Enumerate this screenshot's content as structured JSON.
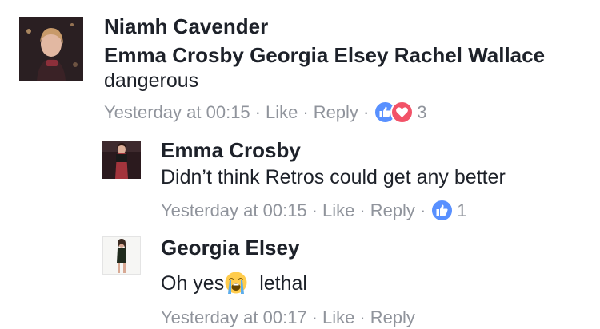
{
  "comment": {
    "author": "Niamh Cavender",
    "tags": "Emma Crosby Georgia Elsey Rachel Wallace",
    "text": "dangerous",
    "time": "Yesterday at 00:15",
    "like": "Like",
    "reply": "Reply",
    "dot": "·",
    "reactions": {
      "icons": [
        "like-icon",
        "love-icon"
      ],
      "count": "3"
    }
  },
  "replies": [
    {
      "author": "Emma Crosby",
      "text": "Didn’t think Retros could get any better",
      "time": "Yesterday at 00:15",
      "like": "Like",
      "reply": "Reply",
      "reactions": {
        "icons": [
          "like-icon"
        ],
        "count": "1"
      }
    },
    {
      "author": "Georgia Elsey",
      "text_before": "Oh yes",
      "emoji": "loudly-crying-face-emoji",
      "text_after": "lethal",
      "time": "Yesterday at 00:17",
      "like": "Like",
      "reply": "Reply"
    }
  ],
  "colors": {
    "text": "#1d2129",
    "meta": "#90949c",
    "like": "#5890ff",
    "love": "#f25268"
  }
}
